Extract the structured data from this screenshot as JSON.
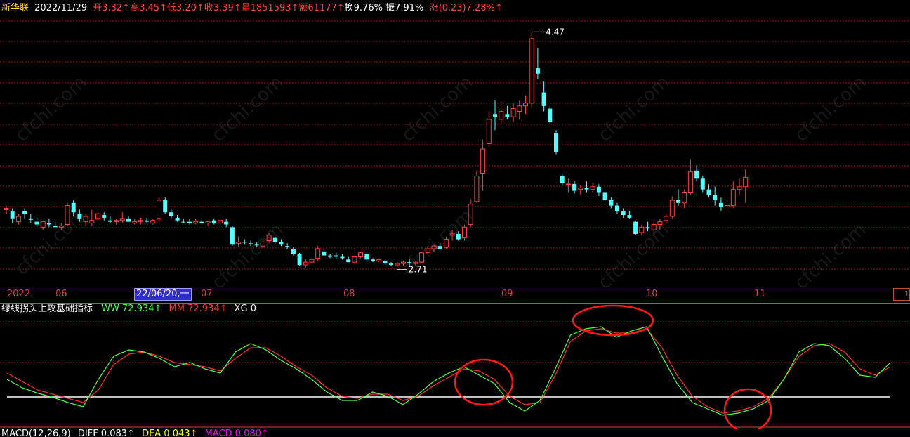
{
  "colors": {
    "bg": "#000000",
    "up": "#ff4040",
    "down": "#54ffff",
    "grid": "#8b1a1a",
    "axis": "#c84c3c",
    "ww": "#4cff4c",
    "mm": "#ff3030",
    "xg": "#ffffff",
    "diff": "#ffffff",
    "dea": "#ffff00",
    "macd": "#ff00ff",
    "highlight": "#ff1a1a"
  },
  "header": {
    "stock_name": "新华联",
    "date": "2022/11/29",
    "open": "开3.32↑",
    "high": "高3.45↑",
    "low": "低3.20↑",
    "close": "收3.39↑",
    "volume": "量1851593↑",
    "amount": "额61177↑",
    "turnover": "换9.76%",
    "amplitude": "振7.91%",
    "change": "涨(0.23)7.28%↑"
  },
  "price_chart": {
    "high_annotation": "4.47",
    "low_annotation": "2.71"
  },
  "time_axis": {
    "labels": [
      "2022",
      "06",
      "07",
      "08",
      "09",
      "10",
      "11"
    ],
    "selected_date": "22/06/20,一",
    "scroll_button": "1"
  },
  "indicator": {
    "name": "绿线拐头上攻基础指标",
    "ww_label": "WW 72.934↑",
    "mm_label": "MM 72.934↑",
    "xg_label": "XG 0"
  },
  "macd": {
    "name": "MACD(12,26,9)",
    "diff_label": "DIFF 0.083↑",
    "dea_label": "DEA 0.043↑",
    "macd_label": "MACD 0.080↑"
  },
  "watermark": "cfchi.com",
  "chart_data": {
    "type": "candlestick",
    "annotations": {
      "max": 4.47,
      "min": 2.71
    },
    "candles": [
      [
        3.15,
        3.18,
        3.12,
        3.16,
        "up"
      ],
      [
        3.14,
        3.16,
        3.05,
        3.08,
        "down"
      ],
      [
        3.06,
        3.12,
        3.04,
        3.1,
        "up"
      ],
      [
        3.12,
        3.16,
        3.08,
        3.14,
        "down"
      ],
      [
        3.08,
        3.12,
        3.05,
        3.08,
        "down"
      ],
      [
        3.06,
        3.09,
        3.02,
        3.04,
        "down"
      ],
      [
        3.02,
        3.07,
        3.0,
        3.06,
        "up"
      ],
      [
        3.05,
        3.08,
        3.02,
        3.04,
        "down"
      ],
      [
        3.03,
        3.06,
        3.01,
        3.02,
        "down"
      ],
      [
        3.02,
        3.05,
        3.0,
        3.03,
        "up"
      ],
      [
        3.04,
        3.2,
        3.03,
        3.18,
        "up"
      ],
      [
        3.2,
        3.22,
        3.1,
        3.13,
        "down"
      ],
      [
        3.12,
        3.15,
        3.06,
        3.08,
        "down"
      ],
      [
        3.06,
        3.12,
        3.03,
        3.1,
        "up"
      ],
      [
        3.05,
        3.15,
        3.03,
        3.07,
        "up"
      ],
      [
        3.08,
        3.14,
        3.05,
        3.12,
        "up"
      ],
      [
        3.11,
        3.13,
        3.07,
        3.09,
        "down"
      ],
      [
        3.07,
        3.1,
        3.05,
        3.06,
        "down"
      ],
      [
        3.06,
        3.08,
        3.04,
        3.07,
        "up"
      ],
      [
        3.07,
        3.13,
        3.05,
        3.08,
        "up"
      ],
      [
        3.08,
        3.1,
        3.06,
        3.06,
        "down"
      ],
      [
        3.05,
        3.08,
        3.04,
        3.06,
        "up"
      ],
      [
        3.06,
        3.09,
        3.04,
        3.07,
        "up"
      ],
      [
        3.07,
        3.09,
        3.05,
        3.06,
        "down"
      ],
      [
        3.05,
        3.08,
        3.04,
        3.07,
        "up"
      ],
      [
        3.08,
        3.24,
        3.06,
        3.22,
        "up"
      ],
      [
        3.22,
        3.24,
        3.12,
        3.13,
        "down"
      ],
      [
        3.13,
        3.15,
        3.08,
        3.1,
        "down"
      ],
      [
        3.09,
        3.11,
        3.06,
        3.07,
        "down"
      ],
      [
        3.06,
        3.08,
        3.05,
        3.06,
        "down"
      ],
      [
        3.06,
        3.08,
        3.04,
        3.05,
        "down"
      ],
      [
        3.05,
        3.08,
        3.04,
        3.06,
        "up"
      ],
      [
        3.06,
        3.08,
        3.04,
        3.05,
        "down"
      ],
      [
        3.05,
        3.07,
        3.03,
        3.06,
        "up"
      ],
      [
        3.07,
        3.08,
        3.04,
        3.05,
        "down"
      ],
      [
        3.05,
        3.1,
        3.03,
        3.07,
        "up"
      ],
      [
        3.06,
        3.08,
        3.02,
        3.04,
        "down"
      ],
      [
        3.02,
        3.03,
        2.88,
        2.89,
        "down"
      ],
      [
        2.9,
        2.95,
        2.87,
        2.91,
        "up"
      ],
      [
        2.91,
        2.93,
        2.89,
        2.91,
        "down"
      ],
      [
        2.9,
        2.92,
        2.88,
        2.9,
        "down"
      ],
      [
        2.89,
        2.91,
        2.87,
        2.89,
        "down"
      ],
      [
        2.88,
        2.93,
        2.87,
        2.91,
        "up"
      ],
      [
        2.92,
        2.98,
        2.9,
        2.96,
        "up"
      ],
      [
        2.94,
        2.95,
        2.9,
        2.91,
        "down"
      ],
      [
        2.91,
        2.93,
        2.88,
        2.89,
        "down"
      ],
      [
        2.88,
        2.9,
        2.86,
        2.87,
        "down"
      ],
      [
        2.86,
        2.87,
        2.81,
        2.82,
        "down"
      ],
      [
        2.82,
        2.83,
        2.73,
        2.74,
        "down"
      ],
      [
        2.74,
        2.78,
        2.72,
        2.76,
        "up"
      ],
      [
        2.76,
        2.79,
        2.75,
        2.78,
        "up"
      ],
      [
        2.79,
        2.88,
        2.77,
        2.86,
        "up"
      ],
      [
        2.84,
        2.86,
        2.8,
        2.81,
        "down"
      ],
      [
        2.8,
        2.82,
        2.79,
        2.81,
        "down"
      ],
      [
        2.81,
        2.83,
        2.79,
        2.8,
        "down"
      ],
      [
        2.8,
        2.82,
        2.78,
        2.79,
        "down"
      ],
      [
        2.78,
        2.8,
        2.76,
        2.76,
        "down"
      ],
      [
        2.76,
        2.81,
        2.75,
        2.8,
        "up"
      ],
      [
        2.8,
        2.84,
        2.79,
        2.83,
        "up"
      ],
      [
        2.82,
        2.83,
        2.77,
        2.78,
        "down"
      ],
      [
        2.78,
        2.79,
        2.76,
        2.77,
        "down"
      ],
      [
        2.77,
        2.79,
        2.76,
        2.78,
        "up"
      ],
      [
        2.77,
        2.78,
        2.74,
        2.75,
        "down"
      ],
      [
        2.75,
        2.76,
        2.73,
        2.74,
        "down"
      ],
      [
        2.74,
        2.76,
        2.71,
        2.75,
        "up"
      ],
      [
        2.75,
        2.77,
        2.73,
        2.76,
        "up"
      ],
      [
        2.76,
        2.78,
        2.73,
        2.75,
        "down"
      ],
      [
        2.75,
        2.77,
        2.73,
        2.76,
        "up"
      ],
      [
        2.76,
        2.84,
        2.75,
        2.83,
        "up"
      ],
      [
        2.83,
        2.88,
        2.82,
        2.86,
        "up"
      ],
      [
        2.86,
        2.89,
        2.84,
        2.88,
        "up"
      ],
      [
        2.88,
        2.9,
        2.85,
        2.86,
        "down"
      ],
      [
        2.87,
        2.95,
        2.86,
        2.93,
        "up"
      ],
      [
        2.96,
        3.0,
        2.92,
        2.97,
        "up"
      ],
      [
        2.97,
        2.99,
        2.92,
        2.93,
        "down"
      ],
      [
        2.94,
        3.04,
        2.92,
        3.02,
        "up"
      ],
      [
        3.04,
        3.23,
        3.02,
        3.19,
        "up"
      ],
      [
        3.21,
        3.44,
        3.2,
        3.4,
        "up"
      ],
      [
        3.42,
        3.67,
        3.29,
        3.6,
        "up"
      ],
      [
        3.64,
        3.88,
        3.62,
        3.82,
        "up"
      ],
      [
        3.84,
        3.96,
        3.74,
        3.86,
        "down"
      ],
      [
        3.82,
        3.95,
        3.78,
        3.88,
        "up"
      ],
      [
        3.86,
        3.92,
        3.82,
        3.84,
        "down"
      ],
      [
        3.84,
        3.94,
        3.8,
        3.9,
        "up"
      ],
      [
        3.88,
        3.96,
        3.82,
        3.92,
        "up"
      ],
      [
        3.92,
        4.0,
        3.86,
        3.94,
        "up"
      ],
      [
        3.94,
        4.47,
        3.9,
        4.42,
        "up"
      ],
      [
        4.2,
        4.35,
        4.12,
        4.16,
        "down"
      ],
      [
        4.02,
        4.1,
        3.88,
        3.92,
        "down"
      ],
      [
        3.9,
        3.92,
        3.78,
        3.8,
        "down"
      ],
      [
        3.72,
        3.74,
        3.56,
        3.58,
        "down"
      ],
      [
        3.4,
        3.42,
        3.33,
        3.35,
        "down"
      ],
      [
        3.34,
        3.38,
        3.28,
        3.34,
        "up"
      ],
      [
        3.34,
        3.36,
        3.27,
        3.29,
        "down"
      ],
      [
        3.3,
        3.33,
        3.26,
        3.31,
        "up"
      ],
      [
        3.31,
        3.36,
        3.28,
        3.3,
        "down"
      ],
      [
        3.3,
        3.35,
        3.28,
        3.32,
        "up"
      ],
      [
        3.32,
        3.34,
        3.25,
        3.28,
        "down"
      ],
      [
        3.28,
        3.3,
        3.2,
        3.22,
        "down"
      ],
      [
        3.22,
        3.24,
        3.16,
        3.18,
        "down"
      ],
      [
        3.18,
        3.2,
        3.12,
        3.14,
        "down"
      ],
      [
        3.14,
        3.16,
        3.09,
        3.11,
        "down"
      ],
      [
        3.11,
        3.14,
        3.08,
        3.09,
        "down"
      ],
      [
        3.06,
        3.07,
        2.96,
        2.97,
        "down"
      ],
      [
        2.98,
        3.04,
        2.96,
        3.02,
        "up"
      ],
      [
        3.02,
        3.06,
        2.99,
        3.01,
        "down"
      ],
      [
        3.0,
        3.06,
        2.97,
        3.04,
        "up"
      ],
      [
        3.04,
        3.08,
        3.0,
        3.06,
        "up"
      ],
      [
        3.07,
        3.12,
        3.05,
        3.1,
        "up"
      ],
      [
        3.1,
        3.25,
        3.08,
        3.22,
        "up"
      ],
      [
        3.22,
        3.3,
        3.18,
        3.2,
        "down"
      ],
      [
        3.2,
        3.3,
        3.16,
        3.28,
        "up"
      ],
      [
        3.28,
        3.52,
        3.26,
        3.43,
        "up"
      ],
      [
        3.44,
        3.48,
        3.36,
        3.38,
        "down"
      ],
      [
        3.38,
        3.4,
        3.28,
        3.3,
        "down"
      ],
      [
        3.3,
        3.34,
        3.24,
        3.26,
        "down"
      ],
      [
        3.26,
        3.32,
        3.18,
        3.22,
        "down"
      ],
      [
        3.2,
        3.24,
        3.14,
        3.17,
        "down"
      ],
      [
        3.17,
        3.22,
        3.14,
        3.18,
        "up"
      ],
      [
        3.18,
        3.36,
        3.16,
        3.3,
        "up"
      ],
      [
        3.3,
        3.38,
        3.26,
        3.32,
        "up"
      ],
      [
        3.32,
        3.45,
        3.2,
        3.39,
        "up"
      ]
    ],
    "indicator_ww": [
      40,
      32,
      27,
      23,
      18,
      14,
      40,
      62,
      68,
      66,
      60,
      52,
      56,
      50,
      46,
      66,
      74,
      68,
      58,
      50,
      40,
      28,
      20,
      20,
      28,
      24,
      16,
      26,
      38,
      46,
      52,
      44,
      36,
      18,
      10,
      20,
      50,
      82,
      88,
      90,
      80,
      86,
      90,
      62,
      36,
      18,
      12,
      6,
      8,
      12,
      20,
      40,
      66,
      74,
      72,
      60,
      44,
      42,
      56
    ],
    "indicator_mm": [
      46,
      38,
      30,
      26,
      22,
      18,
      30,
      54,
      64,
      66,
      62,
      56,
      54,
      52,
      48,
      60,
      70,
      70,
      62,
      52,
      44,
      32,
      24,
      22,
      26,
      26,
      20,
      24,
      34,
      42,
      50,
      48,
      40,
      24,
      16,
      18,
      44,
      76,
      86,
      88,
      84,
      84,
      88,
      70,
      44,
      24,
      14,
      8,
      10,
      14,
      22,
      40,
      62,
      72,
      74,
      66,
      50,
      44,
      52
    ]
  }
}
